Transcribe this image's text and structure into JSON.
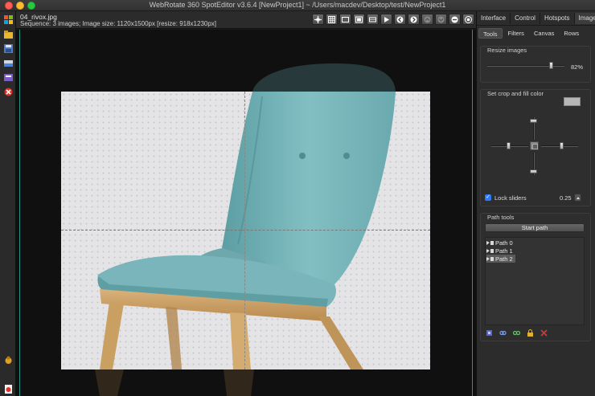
{
  "window": {
    "title": "WebRotate 360 SpotEditor v3.6.4 [NewProject1] ~ /Users/macdev/Desktop/test/NewProject1"
  },
  "info": {
    "file_name": "04_rivox.jpg",
    "sequence": "Sequence: 3 images; Image size: 1120x1500px [resize: 918x1230px]"
  },
  "toolbar_icons": [
    "move-icon",
    "grid-icon",
    "frame-icon",
    "rect-icon",
    "film-icon",
    "play-icon",
    "prev-icon",
    "next-icon",
    "up-icon",
    "down-icon",
    "minus-icon",
    "target-icon"
  ],
  "left_tools": [
    "windows-logo-icon",
    "folder-icon",
    "save-icon",
    "inbox-icon",
    "export-icon",
    "close-icon",
    "bug-icon",
    "pdf-icon"
  ],
  "panel": {
    "tabs": [
      "Interface",
      "Control",
      "Hotspots",
      "Images"
    ],
    "active_tab": "Images",
    "subtabs": [
      "Tools",
      "Filters",
      "Canvas",
      "Rows"
    ],
    "active_subtab": "Tools",
    "resize": {
      "title": "Resize images",
      "value_label": "82%",
      "value": 0.82
    },
    "crop": {
      "title": "Set crop and fill color",
      "fill_color": "#b6b6b6",
      "lock_label": "Lock sliders",
      "lock_checked": true,
      "lock_value": "0.25"
    },
    "paths": {
      "title": "Path tools",
      "start_label": "Start path",
      "items": [
        "Path 0",
        "Path 1",
        "Path 2"
      ],
      "selected": "Path 2"
    },
    "bottom_icons": [
      "select-icon",
      "link-icon",
      "unlink-icon",
      "lock-icon",
      "delete-icon"
    ]
  },
  "colors": {
    "guide": "#2bb5a8",
    "fabric": "#7cb7bb",
    "wood": "#c89e63"
  }
}
